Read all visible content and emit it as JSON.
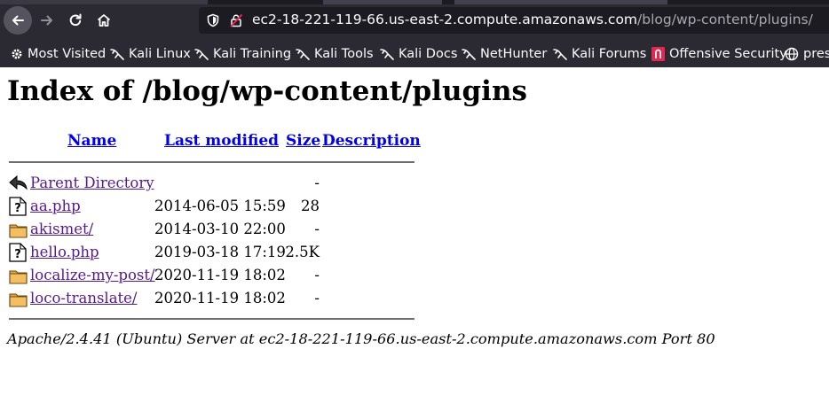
{
  "browser": {
    "url_host": "ec2-18-221-119-66.us-east-2.compute.amazonaws.com",
    "url_path": "/blog/wp-content/plugins/",
    "bookmarks": [
      {
        "label": "Most Visited",
        "icon": "gear-icon"
      },
      {
        "label": "Kali Linux",
        "icon": "kali-dragon-icon"
      },
      {
        "label": "Kali Training",
        "icon": "kali-dragon-icon"
      },
      {
        "label": "Kali Tools",
        "icon": "kali-dragon-icon"
      },
      {
        "label": "Kali Docs",
        "icon": "kali-dragon-icon"
      },
      {
        "label": "NetHunter",
        "icon": "kali-dragon-icon"
      },
      {
        "label": "Kali Forums",
        "icon": "kali-dragon-icon"
      },
      {
        "label": "Offensive Security",
        "icon": "offsec-icon"
      },
      {
        "label": "pres",
        "icon": "globe-icon"
      }
    ]
  },
  "page": {
    "title": "Index of /blog/wp-content/plugins",
    "columns": {
      "name": "Name",
      "last_modified": "Last modified",
      "size": "Size",
      "description": "Description"
    },
    "rows": [
      {
        "name": "Parent Directory",
        "date": "",
        "size": "-",
        "icon": "back-arrow-icon"
      },
      {
        "name": "aa.php",
        "date": "2014-06-05 15:59",
        "size": "28",
        "icon": "unknown-file-icon"
      },
      {
        "name": "akismet/",
        "date": "2014-03-10 22:00",
        "size": "-",
        "icon": "folder-icon"
      },
      {
        "name": "hello.php",
        "date": "2019-03-18 17:19",
        "size": "2.5K",
        "icon": "unknown-file-icon"
      },
      {
        "name": "localize-my-post/",
        "date": "2020-11-19 18:02",
        "size": "-",
        "icon": "folder-icon"
      },
      {
        "name": "loco-translate/",
        "date": "2020-11-19 18:02",
        "size": "-",
        "icon": "folder-icon"
      }
    ],
    "footer": "Apache/2.4.41 (Ubuntu) Server at ec2-18-221-119-66.us-east-2.compute.amazonaws.com Port 80"
  }
}
